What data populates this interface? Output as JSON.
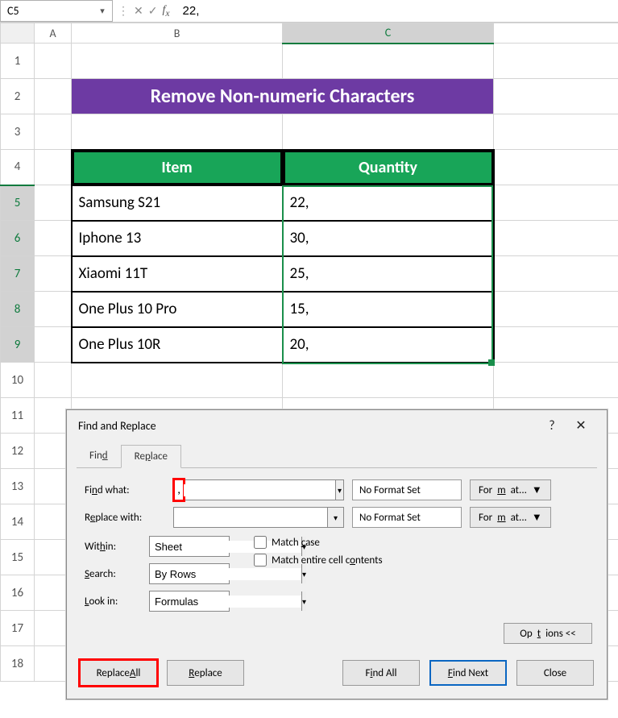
{
  "namebox": "C5",
  "formula": "22,",
  "columns": [
    "A",
    "B",
    "C",
    ""
  ],
  "rows": [
    "1",
    "2",
    "3",
    "4",
    "5",
    "6",
    "7",
    "8",
    "9",
    "10",
    "11",
    "12",
    "13",
    "14",
    "15",
    "16",
    "17",
    "18"
  ],
  "banner": "Remove Non-numeric Characters",
  "table": {
    "headers": [
      "Item",
      "Quantity"
    ],
    "rows": [
      {
        "item": "Samsung S21",
        "qty": "22,"
      },
      {
        "item": "Iphone 13",
        "qty": "30,"
      },
      {
        "item": "Xiaomi 11T",
        "qty": "25,"
      },
      {
        "item": "One Plus 10 Pro",
        "qty": "15,"
      },
      {
        "item": "One Plus 10R",
        "qty": "20,"
      }
    ]
  },
  "dialog": {
    "title": "Find and Replace",
    "tabs": {
      "find": "Find",
      "replace": "Replace"
    },
    "labels": {
      "findwhat": "Find what:",
      "replacewith": "Replace with:",
      "within": "Within:",
      "search": "Search:",
      "lookin": "Look in:",
      "matchcase": "Match case",
      "matchentire": "Match entire cell contents",
      "noformat": "No Format Set",
      "format": "Format...",
      "options": "Options <<"
    },
    "values": {
      "findwhat": ",",
      "replacewith": "",
      "within": "Sheet",
      "search": "By Rows",
      "lookin": "Formulas"
    },
    "buttons": {
      "replaceall": "Replace All",
      "replace": "Replace",
      "findall": "Find All",
      "findnext": "Find Next",
      "close": "Close"
    }
  },
  "icons": {
    "help": "?",
    "close": "✕",
    "dropdown": "▾",
    "dropdown2": "▼"
  }
}
